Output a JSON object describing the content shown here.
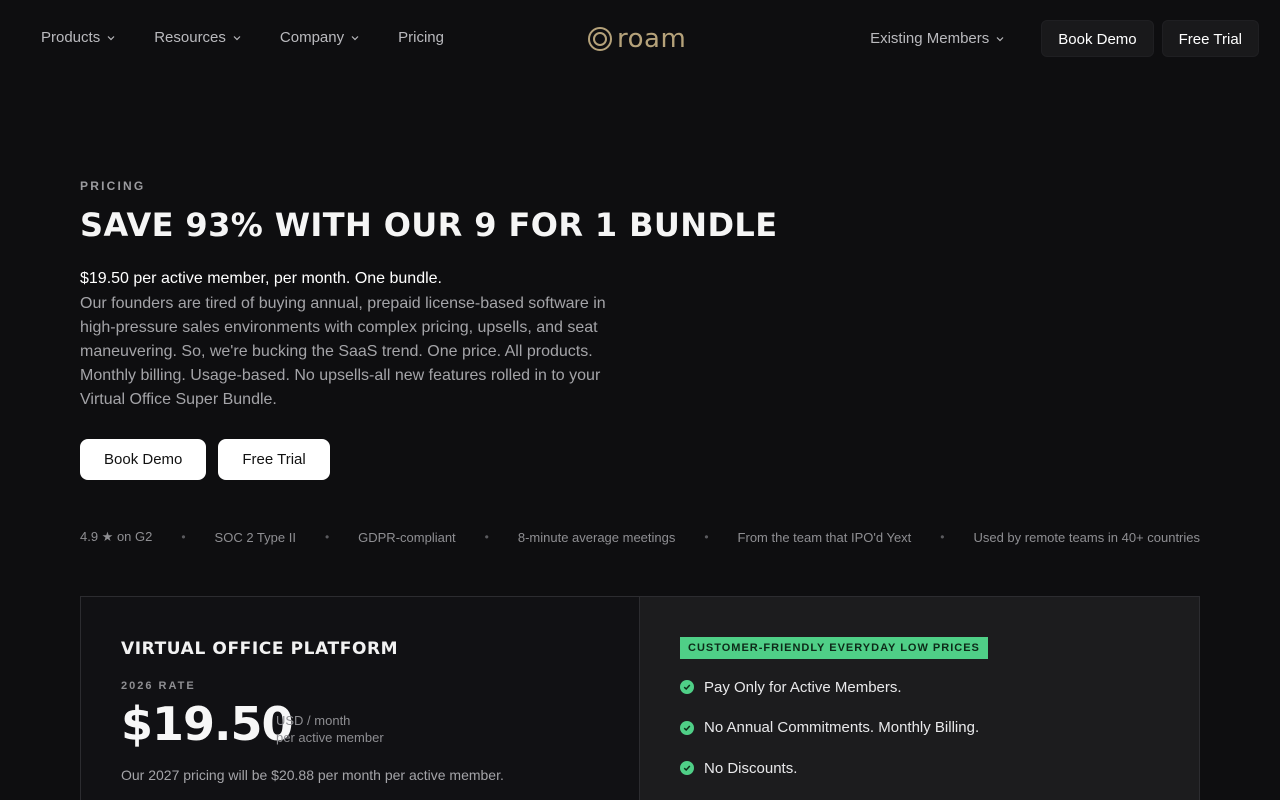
{
  "nav": {
    "links": [
      {
        "label": "Products",
        "has_dropdown": true
      },
      {
        "label": "Resources",
        "has_dropdown": true
      },
      {
        "label": "Company",
        "has_dropdown": true
      },
      {
        "label": "Pricing",
        "has_dropdown": false
      }
    ],
    "logo_text": "roam",
    "existing_members": "Existing Members",
    "book_demo": "Book Demo",
    "free_trial": "Free Trial"
  },
  "hero": {
    "eyebrow": "PRICING",
    "headline": "SAVE 93% WITH OUR 9 FOR 1 BUNDLE",
    "lead": "$19.50 per active member, per month. One bundle.",
    "description": "Our founders are tired of buying annual, prepaid license-based software in high-pressure sales environments with complex pricing, upsells, and seat maneuvering. So, we're bucking the SaaS trend. One price. All products. Monthly billing. Usage-based. No upsells-all new features rolled in to your Virtual Office Super Bundle.",
    "book_demo": "Book Demo",
    "free_trial": "Free Trial"
  },
  "trust": [
    "4.9 ★ on G2",
    "SOC 2 Type II",
    "GDPR-compliant",
    "8-minute average meetings",
    "From the team that IPO'd Yext",
    "Used by remote teams in 40+ countries"
  ],
  "plan": {
    "title": "VIRTUAL OFFICE PLATFORM",
    "rate_label": "2026 RATE",
    "price": "$19.50",
    "unit_line1": "USD / month",
    "unit_line2": "per active member",
    "next_price": "Our 2027 pricing will be $20.88 per month per active member."
  },
  "benefits": {
    "badge": "CUSTOMER-FRIENDLY EVERYDAY LOW PRICES",
    "items": [
      "Pay Only for Active Members.",
      "No Annual Commitments. Monthly Billing.",
      "No Discounts."
    ]
  },
  "colors": {
    "background": "#0e0e10",
    "accent_green": "#4fcf87",
    "logo_gold": "#b5a27a"
  }
}
